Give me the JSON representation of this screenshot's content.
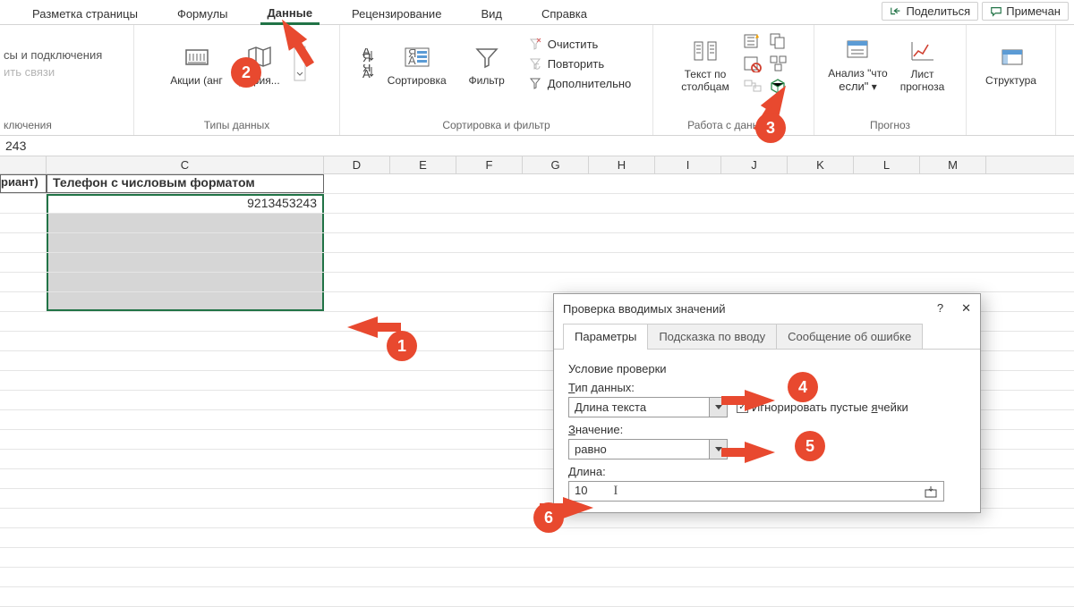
{
  "ribbon": {
    "tabs": [
      "Разметка страницы",
      "Формулы",
      "Данные",
      "Рецензирование",
      "Вид",
      "Справка"
    ],
    "active": "Данные"
  },
  "actions": {
    "share": "Поделиться",
    "comments": "Примечан"
  },
  "conn": {
    "a": "сы и подключения",
    "b": "ить связи",
    "c": "ключения"
  },
  "types": {
    "stocks": "Акции (анг",
    "geo": "рафия...",
    "label": "Типы данных"
  },
  "sort": {
    "sort": "Сортировка",
    "filter": "Фильтр",
    "clear": "Очистить",
    "reapply": "Повторить",
    "adv": "Дополнительно",
    "label": "Сортировка и фильтр"
  },
  "tools": {
    "ttc_a": "Текст по",
    "ttc_b": "столбцам",
    "label": "Работа с данными"
  },
  "forecast": {
    "what_a": "Анализ \"что",
    "what_b": "если\"",
    "sheet_a": "Лист",
    "sheet_b": "прогноза",
    "label": "Прогноз"
  },
  "outline": {
    "label": "Структура"
  },
  "formula": "243",
  "cols": [
    "C",
    "D",
    "E",
    "F",
    "G",
    "H",
    "I",
    "J",
    "K",
    "L",
    "M"
  ],
  "headerA": "риант)",
  "headerB": "Телефон с числовым форматом",
  "cellval": "9213453243",
  "dialog": {
    "title": "Проверка вводимых значений",
    "tabs": [
      "Параметры",
      "Подсказка по вводу",
      "Сообщение об ошибке"
    ],
    "section": "Условие проверки",
    "type_label": "Тип данных:",
    "type_val": "Длина текста",
    "ignore": "Игнорировать пустые ячейки",
    "val_label": "Значение:",
    "val_val": "равно",
    "len_label": "Длина:",
    "len_val": "10"
  },
  "badges": {
    "b1": "1",
    "b2": "2",
    "b3": "3",
    "b4": "4",
    "b5": "5",
    "b6": "6"
  }
}
